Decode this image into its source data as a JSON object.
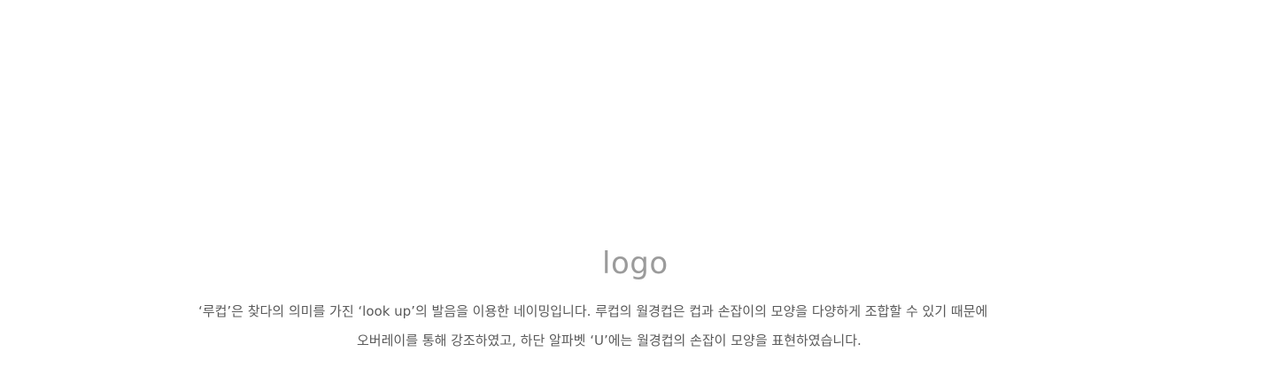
{
  "logo_heading": "logo",
  "description": {
    "line_1": "‘루컵’은 찾다의 의미를 가진 ‘look up’의 발음을 이용한 네이밍입니다. 루컵의 월경컵은 컵과 손잡이의 모양을 다양하게 조합할 수 있기 때문에",
    "line_2": "오버레이를 통해 강조하였고, 하단 알파벳 ‘U’에는 월경컵의 손잡이 모양을 표현하였습니다."
  },
  "colors": {
    "background": "#ffffff",
    "heading": "#9b9b9b",
    "body_text": "#5a5a5a"
  }
}
